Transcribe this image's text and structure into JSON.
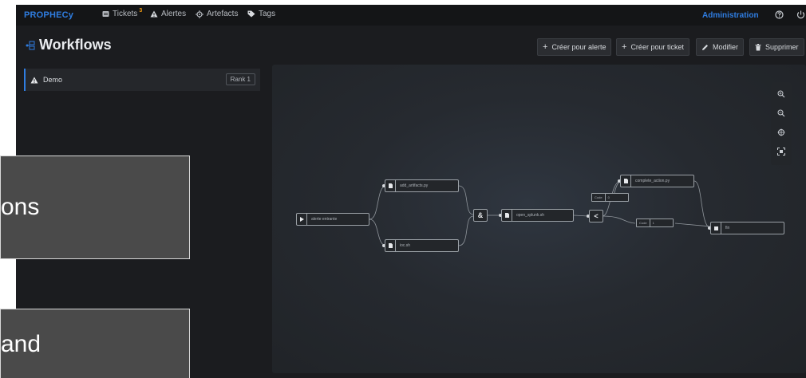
{
  "topbar": {
    "brand": "PROPHECy",
    "nav": [
      {
        "label": "Tickets",
        "badge": "3",
        "icon": "ticket-icon"
      },
      {
        "label": "Alertes",
        "icon": "warning-icon"
      },
      {
        "label": "Artefacts",
        "icon": "artefacts-icon"
      },
      {
        "label": "Tags",
        "icon": "tag-icon"
      }
    ],
    "admin_label": "Administration",
    "help_icon": "help-icon",
    "power_icon": "power-icon"
  },
  "header": {
    "title": "Workflows",
    "title_icon": "workflow-icon",
    "buttons": [
      {
        "label": "Créer pour alerte",
        "icon": "plus-icon"
      },
      {
        "label": "Créer pour ticket",
        "icon": "plus-icon"
      },
      {
        "label": "Modifier",
        "icon": "pencil-icon"
      },
      {
        "label": "Supprimer",
        "icon": "trash-icon"
      }
    ]
  },
  "workflows": [
    {
      "name": "Demo",
      "rank": "Rank 1",
      "icon": "warning-icon"
    }
  ],
  "graph": {
    "nodes": {
      "start": "alerte entrante",
      "add_artifacts": "add_artifacts.py",
      "ioc": "ioc.sh",
      "open_splunk": "open_splunk.sh",
      "complete_action": "complete_action.py",
      "fin": "fin"
    },
    "gates": {
      "merge": "&",
      "branch": "<"
    },
    "conditions": [
      {
        "key": "Code",
        "value": "0"
      },
      {
        "key": "Code",
        "value": "1"
      }
    ],
    "zoom_controls": [
      "zoom-in-icon",
      "zoom-out-icon",
      "center-icon",
      "fit-icon"
    ]
  },
  "overlays": [
    {
      "text": "ons"
    },
    {
      "text": "and"
    }
  ],
  "colors": {
    "accent": "#2f7de1",
    "badge": "#f39c12",
    "background": "#1b1c1f"
  }
}
